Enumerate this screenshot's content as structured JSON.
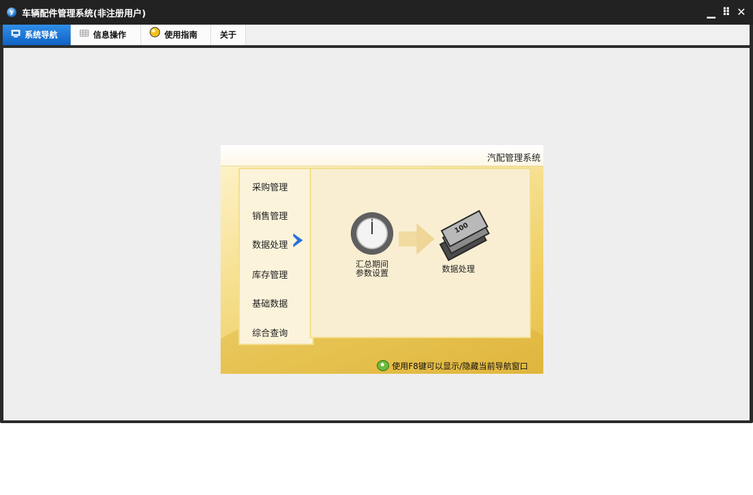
{
  "window": {
    "title": "车辆配件管理系统(非注册用户)",
    "app_icon_letter": "y",
    "controls": {
      "minimize": "▁",
      "restore": "⠿",
      "close": "✕"
    }
  },
  "tabs": [
    {
      "label": "系统导航",
      "icon": "monitor-icon",
      "active": true
    },
    {
      "label": "信息操作",
      "icon": "grid-icon",
      "active": false
    },
    {
      "label": "使用指南",
      "icon": "bulb-icon",
      "active": false
    },
    {
      "label": "关于",
      "active": false
    }
  ],
  "nav_panel": {
    "caption": "汽配管理系统",
    "menu": [
      {
        "label": "采购管理"
      },
      {
        "label": "销售管理"
      },
      {
        "label": "数据处理",
        "selected": true
      },
      {
        "label": "库存管理"
      },
      {
        "label": "基础数据"
      },
      {
        "label": "综合查询"
      }
    ],
    "workflow": {
      "step1_line1": "汇总期间",
      "step1_line2": "参数设置",
      "step2": "数据处理",
      "bill_value": "100"
    },
    "hint": "使用F8键可以显示/隐藏当前导航窗口"
  },
  "colors": {
    "active_tab": "#0f62c4",
    "titlebar": "#222222",
    "content_bg": "#eeeeee",
    "panel_gold": "#efcf63"
  }
}
